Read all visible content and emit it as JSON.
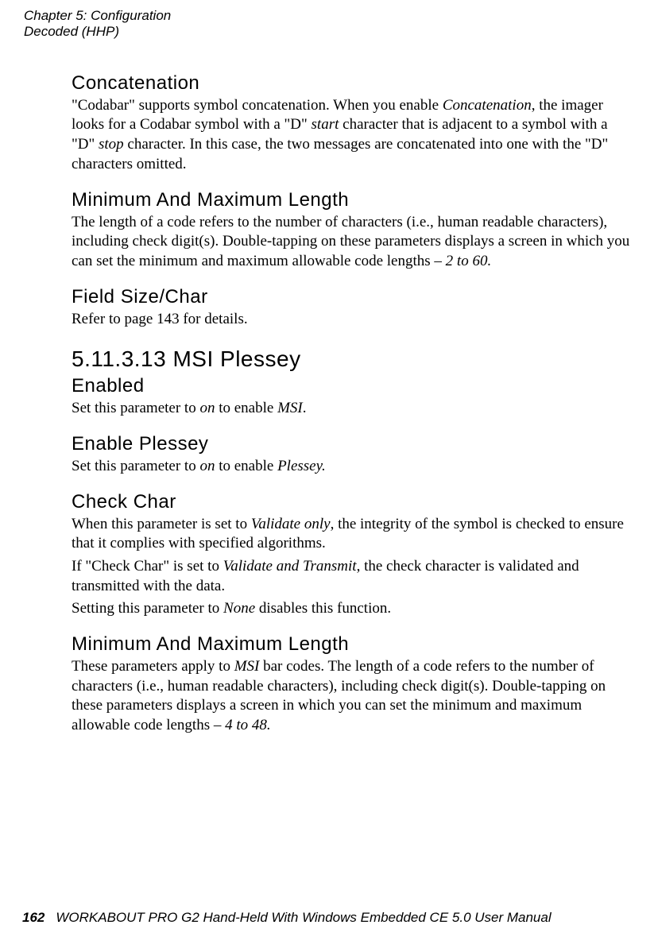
{
  "header": {
    "chapter": "Chapter 5: Configuration",
    "section": "Decoded (HHP)"
  },
  "sections": {
    "concat_h": "Concatenation",
    "concat_p1a": "\"Codabar\" supports symbol concatenation. When you enable ",
    "concat_p1b": "Concatenation",
    "concat_p1c": ", the imager looks for a Codabar symbol with a \"D\" ",
    "concat_p1d": "start",
    "concat_p1e": " character that is adjacent to a symbol with a \"D\" ",
    "concat_p1f": "stop",
    "concat_p1g": " character. In this case, the two messages are concatenated into one with the \"D\" characters omitted.",
    "minmax1_h": "Minimum And Maximum Length",
    "minmax1_p1a": "The length of a code refers to the number of characters (i.e., human readable characters), including check digit(s). Double-tapping on these parameters displays a screen in which you can set the minimum and maximum allowable code lengths – ",
    "minmax1_p1b": "2 to 60.",
    "fsc_h": "Field Size/Char",
    "fsc_p1": "Refer to page 143 for details.",
    "msi_h": "5.11.3.13  MSI Plessey",
    "enabled_h": "Enabled",
    "enabled_p1a": "Set this parameter to ",
    "enabled_p1b": "on",
    "enabled_p1c": " to enable ",
    "enabled_p1d": "MSI",
    "enabled_p1e": ".",
    "eplessey_h": "Enable Plessey",
    "eplessey_p1a": "Set this parameter to ",
    "eplessey_p1b": "on",
    "eplessey_p1c": " to enable ",
    "eplessey_p1d": "Plessey.",
    "chk_h": "Check Char",
    "chk_p1a": "When this parameter is set to ",
    "chk_p1b": "Validate only",
    "chk_p1c": ", the integrity of the symbol is checked to ensure that it complies with specified algorithms.",
    "chk_p2a": "If \"Check Char\" is set to ",
    "chk_p2b": "Validate and Transmit",
    "chk_p2c": ", the check character is validated and transmitted with the data.",
    "chk_p3a": "Setting this parameter to ",
    "chk_p3b": "None",
    "chk_p3c": " disables this function.",
    "minmax2_h": "Minimum And Maximum Length",
    "minmax2_p1a": "These parameters apply to ",
    "minmax2_p1b": "MSI",
    "minmax2_p1c": " bar codes. The length of a code refers to the number of characters (i.e., human readable characters), including check digit(s). Double-tapping on these parameters displays a screen in which you can set the minimum and maximum allowable code lengths – ",
    "minmax2_p1d": "4 to 48."
  },
  "footer": {
    "page": "162",
    "title": "WORKABOUT PRO G2 Hand-Held With Windows Embedded CE 5.0 User Manual"
  }
}
